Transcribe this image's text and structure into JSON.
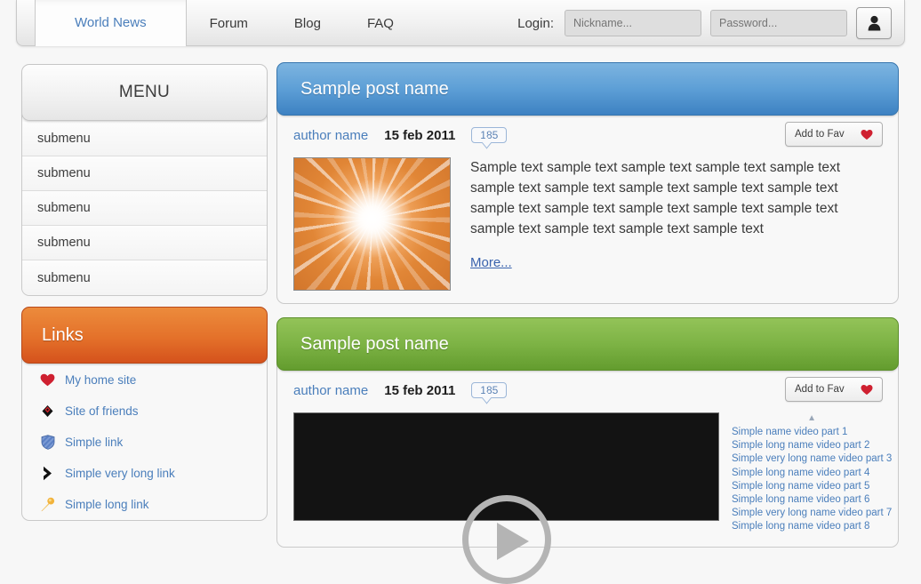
{
  "nav": {
    "tabs": [
      {
        "label": "World News",
        "active": true
      },
      {
        "label": "Forum",
        "active": false
      },
      {
        "label": "Blog",
        "active": false
      },
      {
        "label": "FAQ",
        "active": false
      }
    ],
    "login": {
      "label": "Login:",
      "nickname_placeholder": "Nickname...",
      "nickname_value": "",
      "password_placeholder": "Password...",
      "password_value": "",
      "button_icon": "user-icon"
    }
  },
  "sidebar": {
    "menu": {
      "title": "MENU",
      "items": [
        {
          "label": "submenu"
        },
        {
          "label": "submenu"
        },
        {
          "label": "submenu"
        },
        {
          "label": "submenu"
        },
        {
          "label": "submenu"
        }
      ]
    },
    "links": {
      "title": "Links",
      "items": [
        {
          "label": "My home site",
          "icon": "heart-icon"
        },
        {
          "label": "Site of friends",
          "icon": "diamond-icon"
        },
        {
          "label": "Simple link",
          "icon": "shield-icon"
        },
        {
          "label": "Simple very long link",
          "icon": "chevron-right-icon"
        },
        {
          "label": "Simple long link",
          "icon": "microphone-icon"
        }
      ]
    }
  },
  "posts": [
    {
      "title": "Sample post name",
      "accent": "#3d82c2",
      "author": "author name",
      "date": "15 feb 2011",
      "comments": "185",
      "fav_label": "Add to Fav",
      "fav_icon": "heart-icon",
      "thumbnail": "sunburst-image",
      "text": "Sample text sample text sample text sample text sample text sample text sample text sample text sample text sample text sample text sample text sample text sample text sample text sample text sample text sample text sample text",
      "more_label": "More..."
    },
    {
      "title": "Sample post name",
      "accent": "#639c2e",
      "author": "author name",
      "date": "15 feb 2011",
      "comments": "185",
      "fav_label": "Add to Fav",
      "fav_icon": "heart-icon",
      "player_icon": "play-icon",
      "playlist_scroll_up": "▲",
      "playlist": [
        {
          "label": "Simple name video part 1"
        },
        {
          "label": "Simple long name video part 2"
        },
        {
          "label": "Simple very long name video part 3"
        },
        {
          "label": "Simple long name video part 4"
        },
        {
          "label": "Simple long name video part 5"
        },
        {
          "label": "Simple long name video part 6"
        },
        {
          "label": "Simple very long name video part 7"
        },
        {
          "label": "Simple long name video part 8"
        }
      ]
    }
  ]
}
